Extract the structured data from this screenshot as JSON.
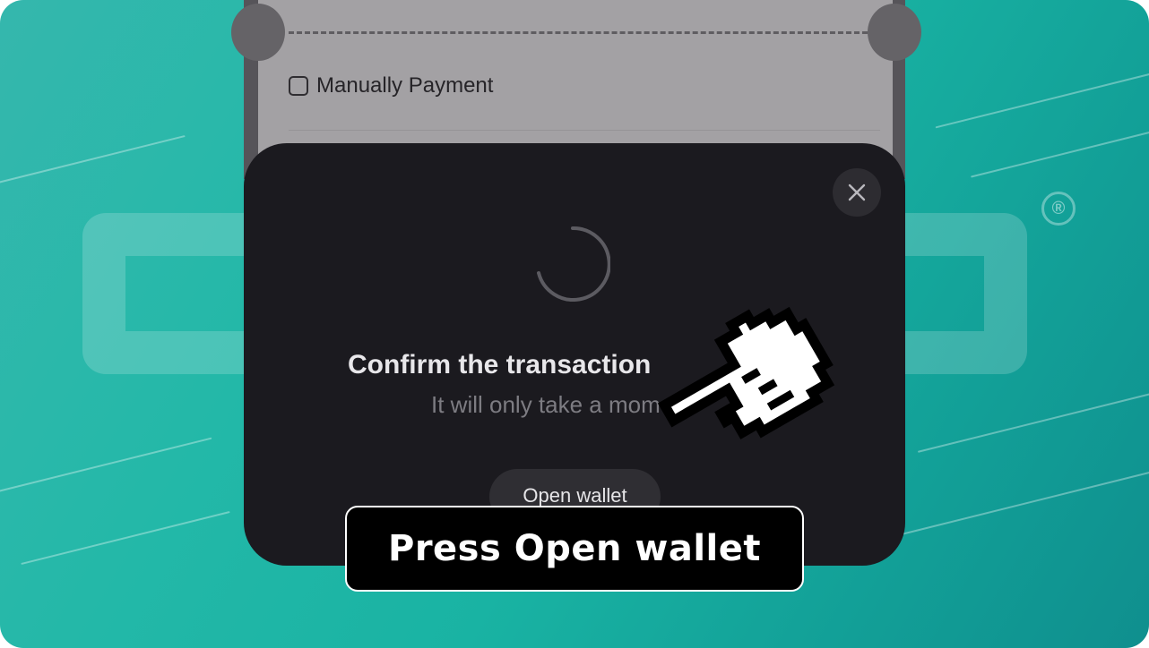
{
  "background": {
    "accent_color": "#1fb5a5",
    "watermark_symbol": "®"
  },
  "payment_screen": {
    "manual_payment_label": "Manually Payment",
    "manual_payment_checked": false
  },
  "wallet_sheet": {
    "close_icon": "close-icon",
    "spinner_icon": "loading-spinner-icon",
    "title": "Confirm the transaction",
    "subtitle": "It will only take a moment",
    "open_wallet_label": "Open wallet"
  },
  "tutorial": {
    "pointer_icon": "pointing-hand-cursor-icon",
    "caption": "Press Open wallet"
  }
}
